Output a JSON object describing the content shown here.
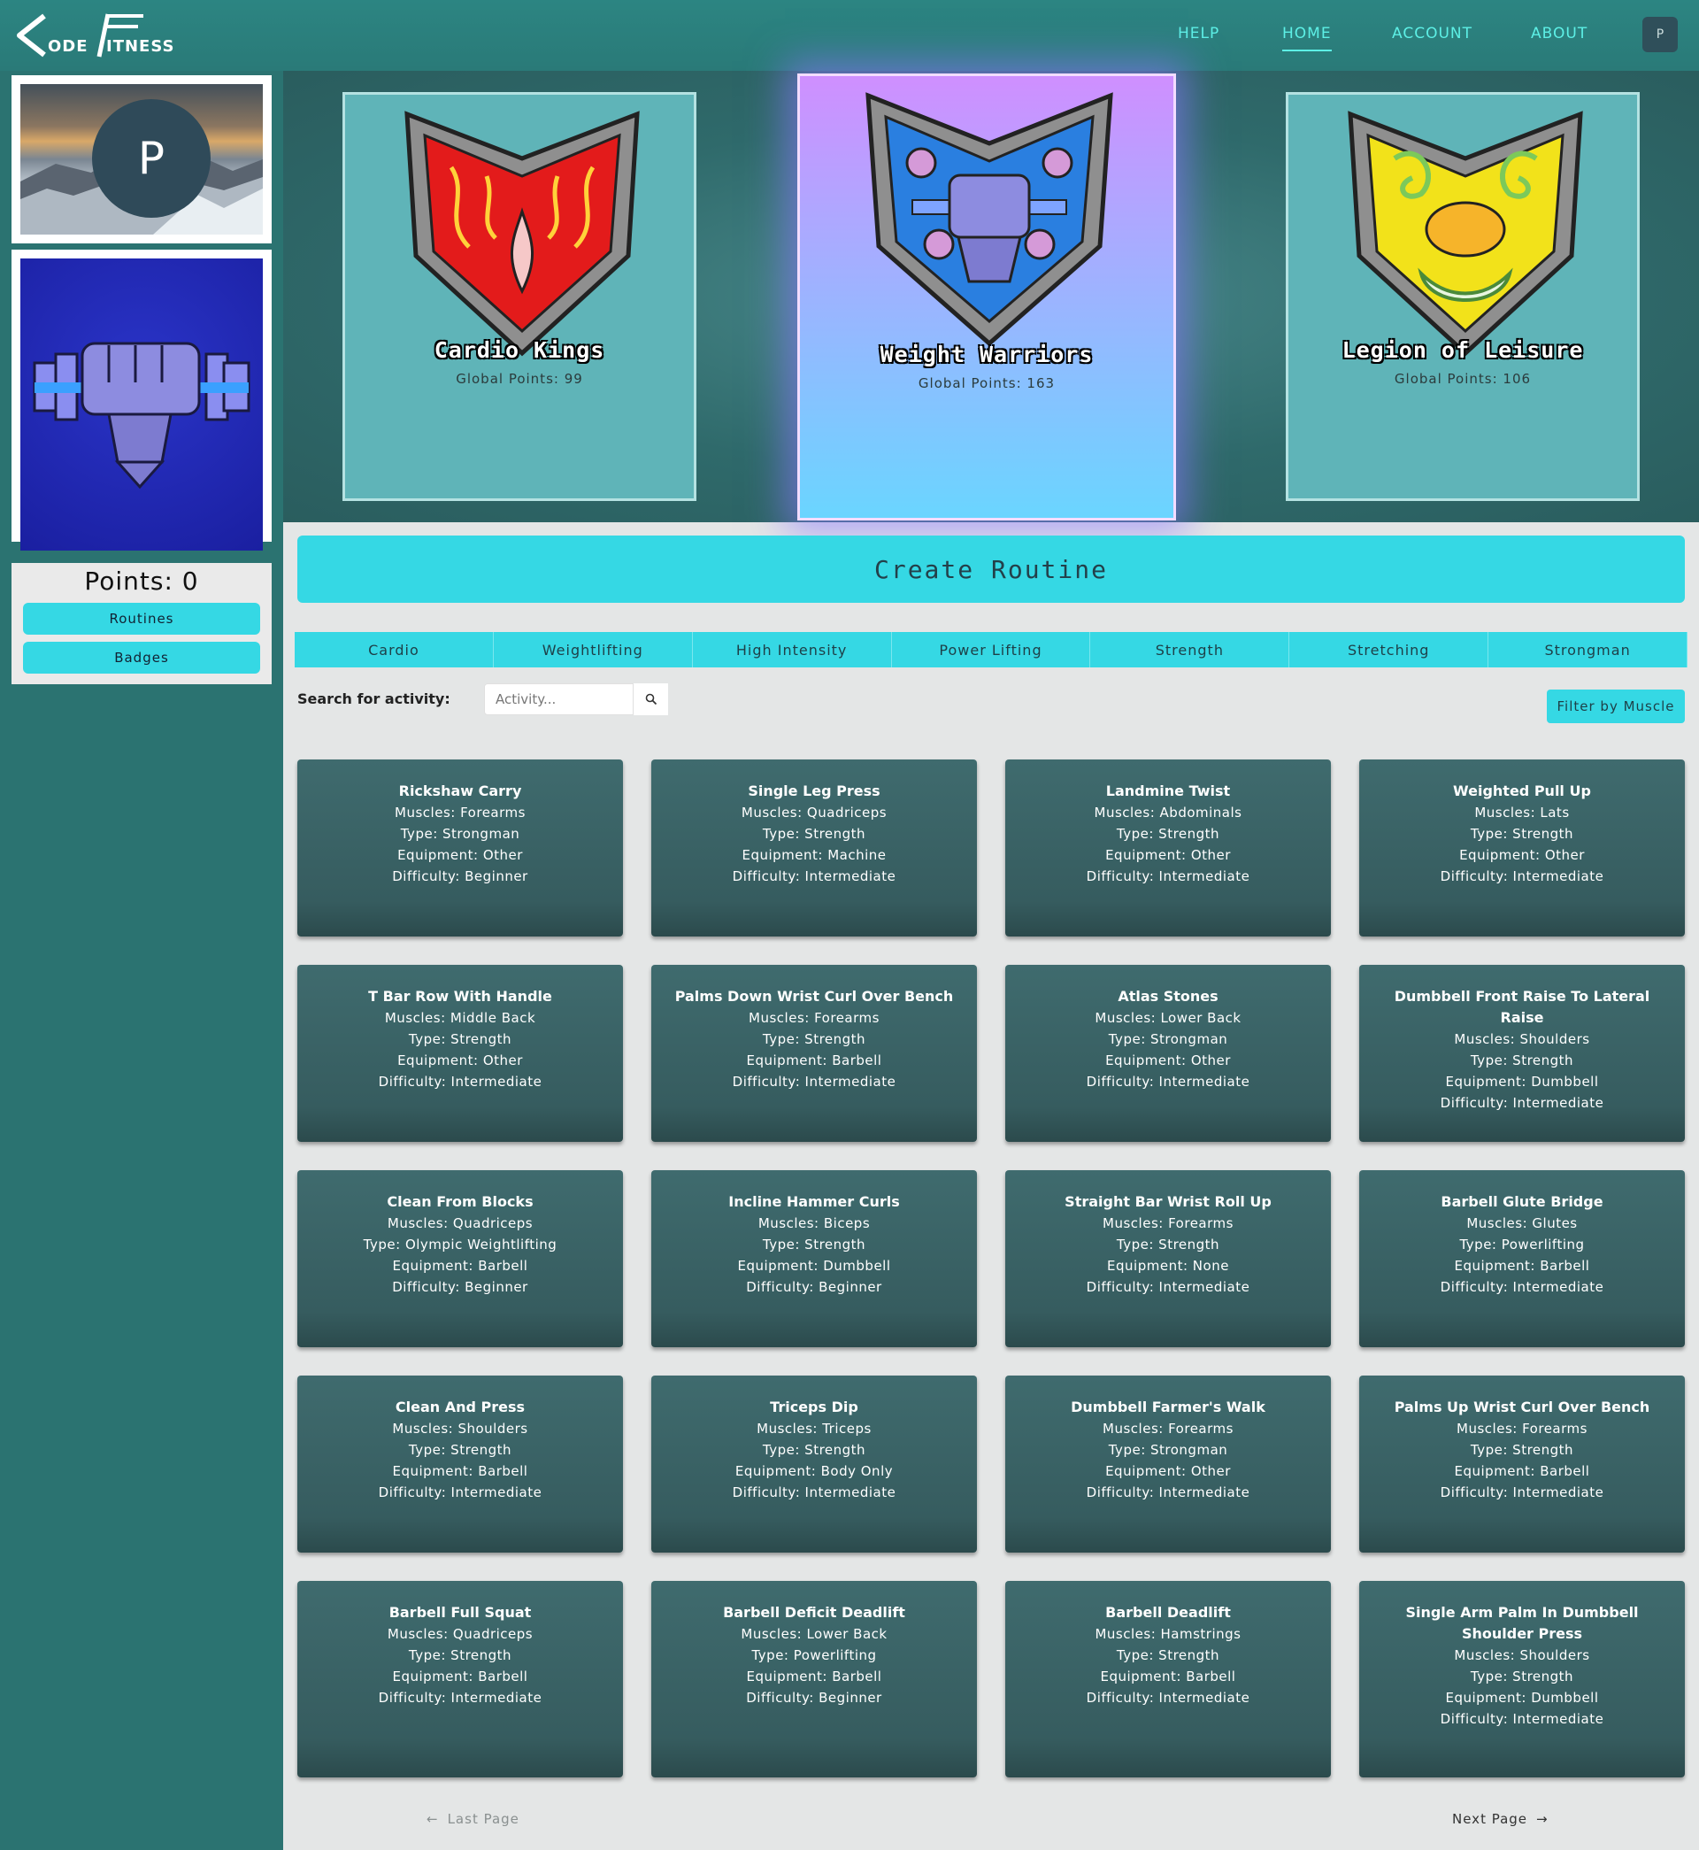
{
  "header": {
    "logo_part1": "ODE",
    "logo_part2": "ITNESS",
    "nav": [
      "HELP",
      "HOME",
      "ACCOUNT",
      "ABOUT"
    ],
    "active_nav": "HOME",
    "avatar_initial": "P"
  },
  "sidebar": {
    "profile_initial": "P",
    "points_label": "Points: 0",
    "buttons": [
      "Routines",
      "Badges"
    ]
  },
  "teams": [
    {
      "name": "Cardio Kings",
      "points_label": "Global Points: 99",
      "color": "#e31b1b",
      "featured": false
    },
    {
      "name": "Weight Warriors",
      "points_label": "Global Points: 163",
      "color": "#2a7fe0",
      "featured": true
    },
    {
      "name": "Legion of Leisure",
      "points_label": "Global Points: 106",
      "color": "#f2e21a",
      "featured": false
    }
  ],
  "create_routine_label": "Create Routine",
  "categories": [
    "Cardio",
    "Weightlifting",
    "High Intensity",
    "Power Lifting",
    "Strength",
    "Stretching",
    "Strongman"
  ],
  "search": {
    "label": "Search for activity:",
    "placeholder": "Activity..."
  },
  "filter_label": "Filter by Muscle",
  "exercises": [
    {
      "name": "Rickshaw Carry",
      "muscles": "Muscles: Forearms",
      "type": "Type: Strongman",
      "equipment": "Equipment: Other",
      "difficulty": "Difficulty: Beginner"
    },
    {
      "name": "Single Leg Press",
      "muscles": "Muscles: Quadriceps",
      "type": "Type: Strength",
      "equipment": "Equipment: Machine",
      "difficulty": "Difficulty: Intermediate"
    },
    {
      "name": "Landmine Twist",
      "muscles": "Muscles: Abdominals",
      "type": "Type: Strength",
      "equipment": "Equipment: Other",
      "difficulty": "Difficulty: Intermediate"
    },
    {
      "name": "Weighted Pull Up",
      "muscles": "Muscles: Lats",
      "type": "Type: Strength",
      "equipment": "Equipment: Other",
      "difficulty": "Difficulty: Intermediate"
    },
    {
      "name": "T Bar Row With Handle",
      "muscles": "Muscles: Middle Back",
      "type": "Type: Strength",
      "equipment": "Equipment: Other",
      "difficulty": "Difficulty: Intermediate"
    },
    {
      "name": "Palms Down Wrist Curl Over Bench",
      "muscles": "Muscles: Forearms",
      "type": "Type: Strength",
      "equipment": "Equipment: Barbell",
      "difficulty": "Difficulty: Intermediate"
    },
    {
      "name": "Atlas Stones",
      "muscles": "Muscles: Lower Back",
      "type": "Type: Strongman",
      "equipment": "Equipment: Other",
      "difficulty": "Difficulty: Intermediate"
    },
    {
      "name": "Dumbbell Front Raise To Lateral Raise",
      "muscles": "Muscles: Shoulders",
      "type": "Type: Strength",
      "equipment": "Equipment: Dumbbell",
      "difficulty": "Difficulty: Intermediate"
    },
    {
      "name": "Clean From Blocks",
      "muscles": "Muscles: Quadriceps",
      "type": "Type: Olympic Weightlifting",
      "equipment": "Equipment: Barbell",
      "difficulty": "Difficulty: Beginner"
    },
    {
      "name": "Incline Hammer Curls",
      "muscles": "Muscles: Biceps",
      "type": "Type: Strength",
      "equipment": "Equipment: Dumbbell",
      "difficulty": "Difficulty: Beginner"
    },
    {
      "name": "Straight Bar Wrist Roll Up",
      "muscles": "Muscles: Forearms",
      "type": "Type: Strength",
      "equipment": "Equipment: None",
      "difficulty": "Difficulty: Intermediate"
    },
    {
      "name": "Barbell Glute Bridge",
      "muscles": "Muscles: Glutes",
      "type": "Type: Powerlifting",
      "equipment": "Equipment: Barbell",
      "difficulty": "Difficulty: Intermediate"
    },
    {
      "name": "Clean And Press",
      "muscles": "Muscles: Shoulders",
      "type": "Type: Strength",
      "equipment": "Equipment: Barbell",
      "difficulty": "Difficulty: Intermediate"
    },
    {
      "name": "Triceps Dip",
      "muscles": "Muscles: Triceps",
      "type": "Type: Strength",
      "equipment": "Equipment: Body Only",
      "difficulty": "Difficulty: Intermediate"
    },
    {
      "name": "Dumbbell Farmer's Walk",
      "muscles": "Muscles: Forearms",
      "type": "Type: Strongman",
      "equipment": "Equipment: Other",
      "difficulty": "Difficulty: Intermediate"
    },
    {
      "name": "Palms Up Wrist Curl Over Bench",
      "muscles": "Muscles: Forearms",
      "type": "Type: Strength",
      "equipment": "Equipment: Barbell",
      "difficulty": "Difficulty: Intermediate"
    },
    {
      "name": "Barbell Full Squat",
      "muscles": "Muscles: Quadriceps",
      "type": "Type: Strength",
      "equipment": "Equipment: Barbell",
      "difficulty": "Difficulty: Intermediate"
    },
    {
      "name": "Barbell Deficit Deadlift",
      "muscles": "Muscles: Lower Back",
      "type": "Type: Powerlifting",
      "equipment": "Equipment: Barbell",
      "difficulty": "Difficulty: Beginner"
    },
    {
      "name": "Barbell Deadlift",
      "muscles": "Muscles: Hamstrings",
      "type": "Type: Strength",
      "equipment": "Equipment: Barbell",
      "difficulty": "Difficulty: Intermediate"
    },
    {
      "name": "Single Arm Palm In Dumbbell Shoulder Press",
      "muscles": "Muscles: Shoulders",
      "type": "Type: Strength",
      "equipment": "Equipment: Dumbbell",
      "difficulty": "Difficulty: Intermediate"
    }
  ],
  "pagination": {
    "prev_label": "Last Page",
    "next_label": "Next Page"
  },
  "icons": {
    "search": "search-icon",
    "prev": "arrow-left-icon",
    "next": "arrow-right-icon"
  }
}
